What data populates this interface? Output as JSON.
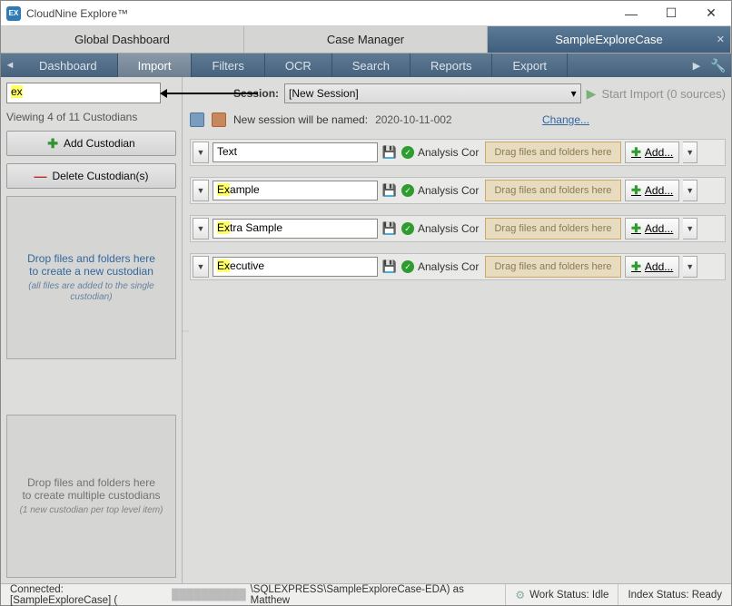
{
  "titlebar": {
    "app_name": "CloudNine Explore™",
    "icon_text": "EX"
  },
  "case_tabs": {
    "items": [
      {
        "label": "Global Dashboard"
      },
      {
        "label": "Case Manager"
      },
      {
        "label": "SampleExploreCase"
      }
    ]
  },
  "nav": {
    "items": [
      {
        "label": "Dashboard"
      },
      {
        "label": "Import"
      },
      {
        "label": "Filters"
      },
      {
        "label": "OCR"
      },
      {
        "label": "Search"
      },
      {
        "label": "Reports"
      },
      {
        "label": "Export"
      }
    ]
  },
  "left": {
    "filter_value": "ex",
    "viewing": "Viewing 4 of 11 Custodians",
    "add_btn": "Add Custodian",
    "delete_btn": "Delete Custodian(s)",
    "drop1_line1": "Drop files and folders here",
    "drop1_line2": "to create a new custodian",
    "drop1_hint": "(all files are added to the single custodian)",
    "drop2_line1": "Drop files and folders here",
    "drop2_line2": "to create multiple custodians",
    "drop2_hint": "(1 new custodian per top level item)"
  },
  "main": {
    "session_label": "Session:",
    "session_value": "[New Session]",
    "start_import": "Start Import (0 sources)",
    "new_session_label": "New session will be named:",
    "new_session_name": "2020-10-11-002",
    "change": "Change...",
    "status_text": "Analysis Cor",
    "drop_text": "Drag files and folders here",
    "add_text": "Add...",
    "rows": [
      {
        "name": "Text",
        "hl": ""
      },
      {
        "name": "Example",
        "hl": "Ex",
        "rest": "ample"
      },
      {
        "name": "Extra Sample",
        "hl": "Ex",
        "rest": "tra Sample"
      },
      {
        "name": "Executive",
        "hl": "Ex",
        "rest": "ecutive"
      }
    ]
  },
  "status": {
    "connected": "Connected: [SampleExploreCase] (",
    "connected2": "\\SQLEXPRESS\\SampleExploreCase-EDA) as Matthew",
    "work": "Work Status: Idle",
    "index": "Index Status: Ready"
  }
}
